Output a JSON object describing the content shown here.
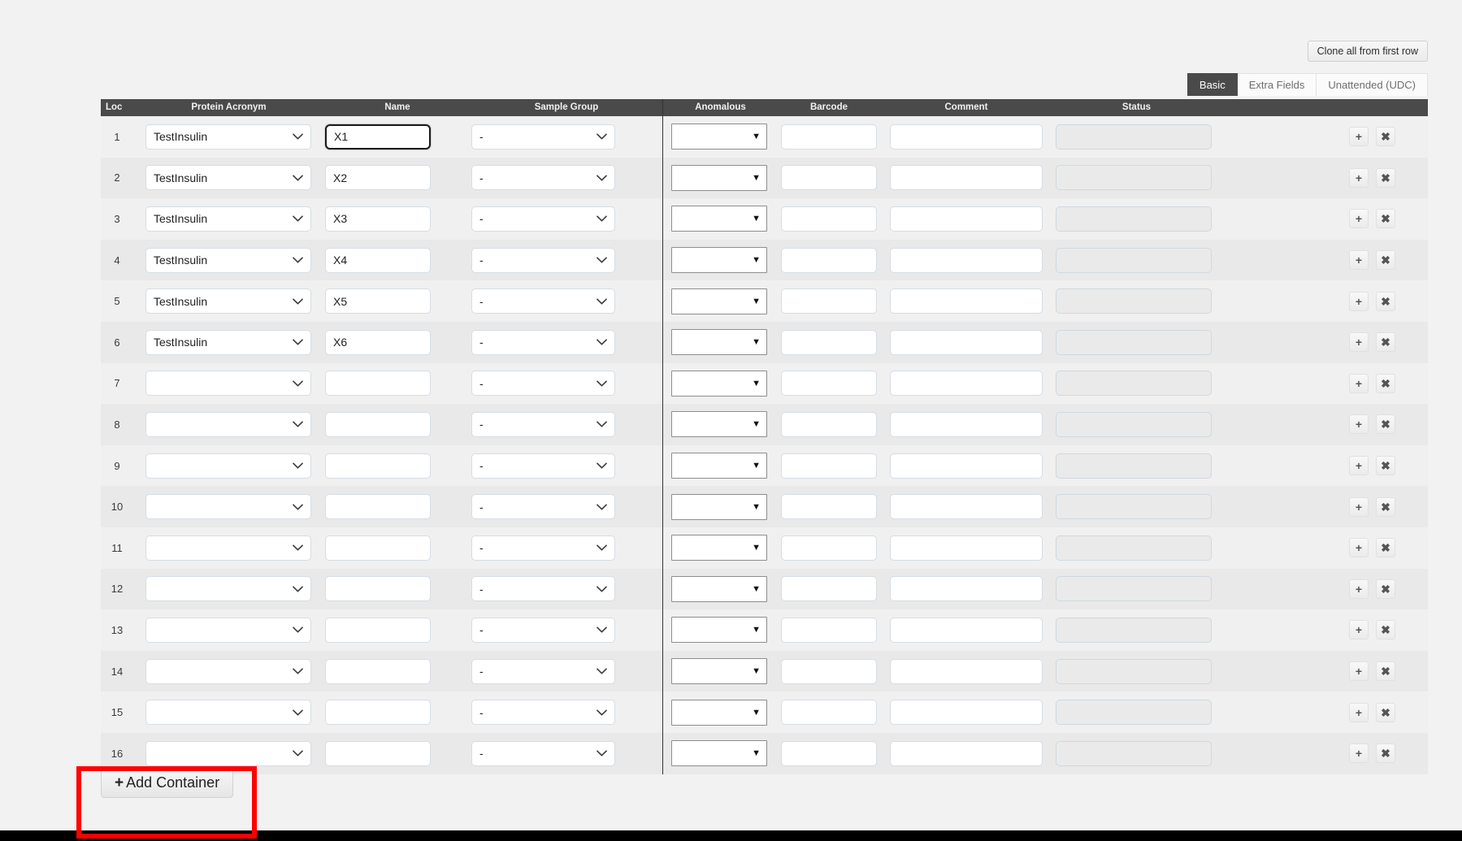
{
  "toolbar": {
    "clone_button": "Clone all from first row"
  },
  "tabs": [
    {
      "label": "Basic",
      "active": true
    },
    {
      "label": "Extra Fields",
      "active": false
    },
    {
      "label": "Unattended (UDC)",
      "active": false
    }
  ],
  "table": {
    "headers": {
      "loc": "Loc",
      "protein_acronym": "Protein Acronym",
      "name": "Name",
      "sample_group": "Sample Group",
      "anomalous": "Anomalous",
      "barcode": "Barcode",
      "comment": "Comment",
      "status": "Status"
    },
    "rows": [
      {
        "loc": "1",
        "protein_acronym": "TestInsulin",
        "name": "X1",
        "sample_group": "-",
        "anomalous": "",
        "barcode": "",
        "comment": "",
        "status": "",
        "name_focused": true
      },
      {
        "loc": "2",
        "protein_acronym": "TestInsulin",
        "name": "X2",
        "sample_group": "-",
        "anomalous": "",
        "barcode": "",
        "comment": "",
        "status": "",
        "name_focused": false
      },
      {
        "loc": "3",
        "protein_acronym": "TestInsulin",
        "name": "X3",
        "sample_group": "-",
        "anomalous": "",
        "barcode": "",
        "comment": "",
        "status": "",
        "name_focused": false
      },
      {
        "loc": "4",
        "protein_acronym": "TestInsulin",
        "name": "X4",
        "sample_group": "-",
        "anomalous": "",
        "barcode": "",
        "comment": "",
        "status": "",
        "name_focused": false
      },
      {
        "loc": "5",
        "protein_acronym": "TestInsulin",
        "name": "X5",
        "sample_group": "-",
        "anomalous": "",
        "barcode": "",
        "comment": "",
        "status": "",
        "name_focused": false
      },
      {
        "loc": "6",
        "protein_acronym": "TestInsulin",
        "name": "X6",
        "sample_group": "-",
        "anomalous": "",
        "barcode": "",
        "comment": "",
        "status": "",
        "name_focused": false
      },
      {
        "loc": "7",
        "protein_acronym": "",
        "name": "",
        "sample_group": "-",
        "anomalous": "",
        "barcode": "",
        "comment": "",
        "status": "",
        "name_focused": false
      },
      {
        "loc": "8",
        "protein_acronym": "",
        "name": "",
        "sample_group": "-",
        "anomalous": "",
        "barcode": "",
        "comment": "",
        "status": "",
        "name_focused": false
      },
      {
        "loc": "9",
        "protein_acronym": "",
        "name": "",
        "sample_group": "-",
        "anomalous": "",
        "barcode": "",
        "comment": "",
        "status": "",
        "name_focused": false
      },
      {
        "loc": "10",
        "protein_acronym": "",
        "name": "",
        "sample_group": "-",
        "anomalous": "",
        "barcode": "",
        "comment": "",
        "status": "",
        "name_focused": false
      },
      {
        "loc": "11",
        "protein_acronym": "",
        "name": "",
        "sample_group": "-",
        "anomalous": "",
        "barcode": "",
        "comment": "",
        "status": "",
        "name_focused": false
      },
      {
        "loc": "12",
        "protein_acronym": "",
        "name": "",
        "sample_group": "-",
        "anomalous": "",
        "barcode": "",
        "comment": "",
        "status": "",
        "name_focused": false
      },
      {
        "loc": "13",
        "protein_acronym": "",
        "name": "",
        "sample_group": "-",
        "anomalous": "",
        "barcode": "",
        "comment": "",
        "status": "",
        "name_focused": false
      },
      {
        "loc": "14",
        "protein_acronym": "",
        "name": "",
        "sample_group": "-",
        "anomalous": "",
        "barcode": "",
        "comment": "",
        "status": "",
        "name_focused": false
      },
      {
        "loc": "15",
        "protein_acronym": "",
        "name": "",
        "sample_group": "-",
        "anomalous": "",
        "barcode": "",
        "comment": "",
        "status": "",
        "name_focused": false
      },
      {
        "loc": "16",
        "protein_acronym": "",
        "name": "",
        "sample_group": "-",
        "anomalous": "",
        "barcode": "",
        "comment": "",
        "status": "",
        "name_focused": false
      }
    ],
    "row_actions": {
      "add_icon": "plus-icon",
      "remove_icon": "close-icon",
      "add_label": "+",
      "remove_label": "✖"
    }
  },
  "footer": {
    "add_container_label": "Add Container",
    "add_container_plus": "+"
  },
  "annotation": {
    "highlight_color": "#ff0000",
    "highlight_target": "add-container-button"
  },
  "colors": {
    "header_bar": "#4a4a4a",
    "row_odd": "#f0f0f0",
    "row_even": "#e9e9e9",
    "page_background": "#f2f2f2",
    "bottom_bar": "#000000",
    "active_tab": "#4a4a4a"
  }
}
